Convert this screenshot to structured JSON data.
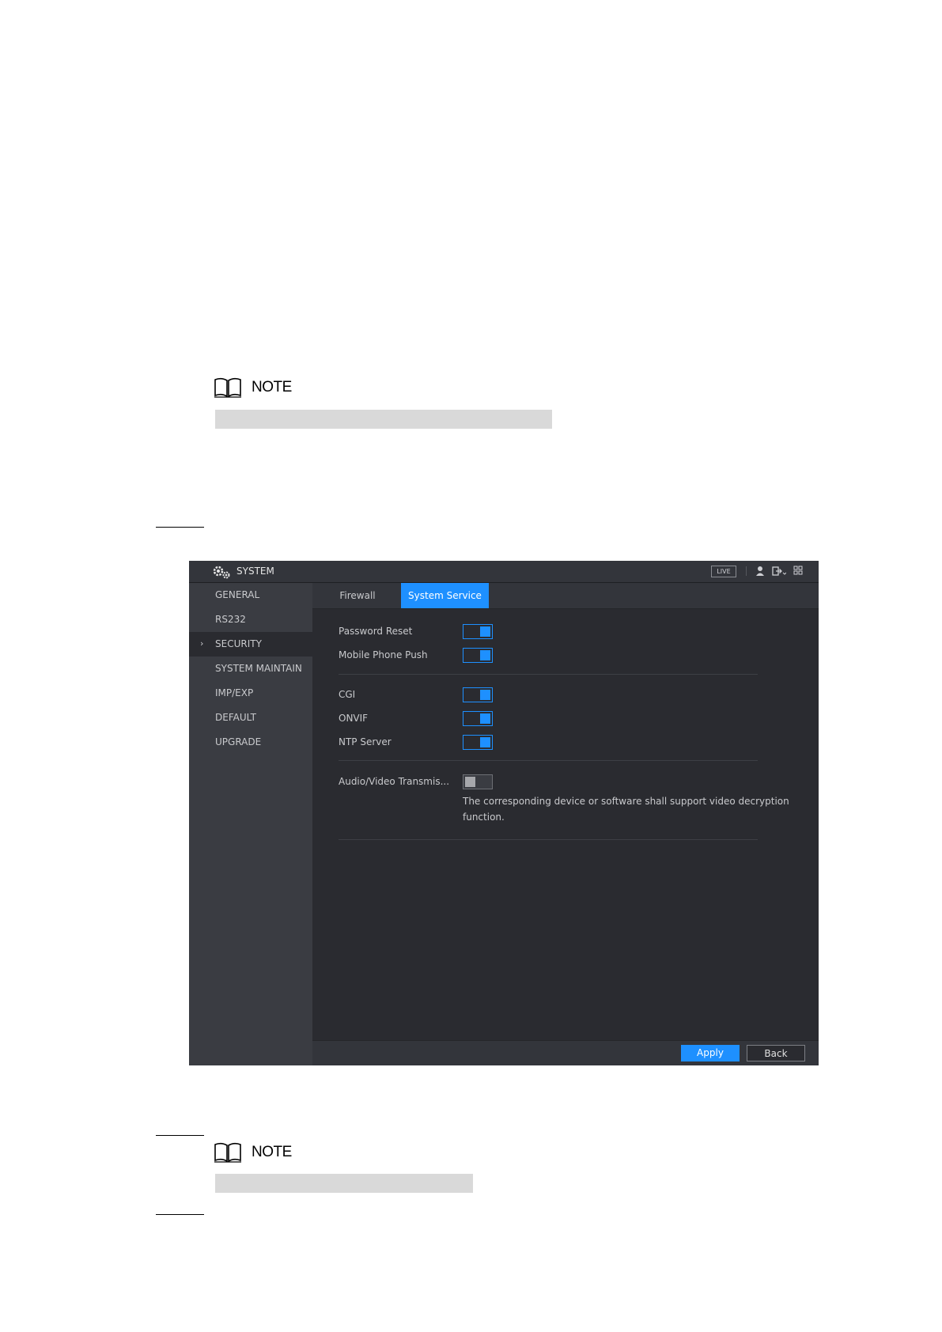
{
  "doc": {
    "note_label_1": "NOTE",
    "note_label_2": "NOTE"
  },
  "window": {
    "title": "SYSTEM",
    "live_label": "LIVE"
  },
  "sidebar": {
    "items": [
      {
        "label": "GENERAL"
      },
      {
        "label": "RS232"
      },
      {
        "label": "SECURITY",
        "active": true
      },
      {
        "label": "SYSTEM MAINTAIN"
      },
      {
        "label": "IMP/EXP"
      },
      {
        "label": "DEFAULT"
      },
      {
        "label": "UPGRADE"
      }
    ]
  },
  "tabs": {
    "firewall": "Firewall",
    "system_service": "System Service",
    "active": "System Service"
  },
  "services": {
    "password_reset": {
      "label": "Password Reset",
      "enabled": true
    },
    "mobile_phone_push": {
      "label": "Mobile Phone Push",
      "enabled": true
    },
    "cgi": {
      "label": "CGI",
      "enabled": true
    },
    "onvif": {
      "label": "ONVIF",
      "enabled": true
    },
    "ntp_server": {
      "label": "NTP Server",
      "enabled": true
    },
    "av_transmission": {
      "label": "Audio/Video Transmis...",
      "enabled": false
    },
    "av_hint": "The corresponding device or software shall support video decryption function."
  },
  "footer": {
    "apply": "Apply",
    "back": "Back"
  },
  "colors": {
    "accent": "#1e90ff",
    "panel": "#2a2b30",
    "sidebar": "#3a3c42"
  }
}
